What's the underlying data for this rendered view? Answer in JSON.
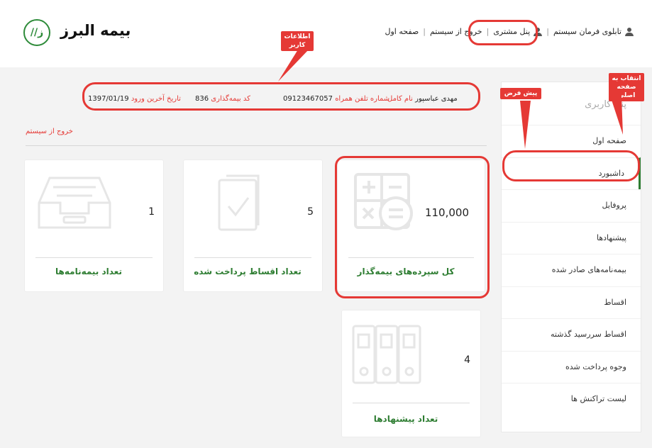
{
  "brand": {
    "logo_text": "بیمه البرز",
    "logo_mark": "//ز"
  },
  "topnav": {
    "dashboard": "تابلوی فرمان سیستم",
    "customer_panel": "پنل مشتری",
    "logout": "خروج از سیستم",
    "home": "صفحه اول",
    "separator": "|"
  },
  "user_info": {
    "fullname_label": "نام کامل",
    "fullname_value": "مهدی عباسپور",
    "phone_label": "شماره تلفن همراه",
    "phone_value": "09123467057",
    "insurer_code_label": "کد بیمه‌گذاری",
    "insurer_code_value": "836",
    "last_login_label": "تاریخ آخرین ورود",
    "last_login_value": "1397/01/19",
    "logout_link": "خروج از سیستم"
  },
  "cards": [
    {
      "value": "110,000",
      "label": "کل سپرده‌های بیمه‌گذار",
      "icon": "calculator-icon"
    },
    {
      "value": "5",
      "label": "تعداد اقساط پرداخت شده",
      "icon": "checklist-icon"
    },
    {
      "value": "1",
      "label": "تعداد بیمه‌نامه‌ها",
      "icon": "inbox-tray-icon"
    },
    {
      "value": "4",
      "label": "تعداد پیشنهادها",
      "icon": "binders-icon"
    }
  ],
  "sidebar": {
    "title": "پنل کاربری",
    "items": [
      {
        "label": "صفحه اول"
      },
      {
        "label": "داشبورد"
      },
      {
        "label": "پروفایل"
      },
      {
        "label": "پیشنهادها"
      },
      {
        "label": "بیمه‌نامه‌های صادر شده"
      },
      {
        "label": "اقساط"
      },
      {
        "label": "اقساط سررسید گذشته"
      },
      {
        "label": "وجوه پرداخت شده"
      },
      {
        "label": "لیست تراکنش ها"
      }
    ]
  },
  "annotations": {
    "user_info": "اطلاعات کاربر",
    "default": "پیش فرض",
    "main_page": "انتقاب به صفحه اصلی"
  },
  "colors": {
    "accent_green": "#2e7d32",
    "annotation_red": "#e53935",
    "background": "#f3f3f3"
  }
}
